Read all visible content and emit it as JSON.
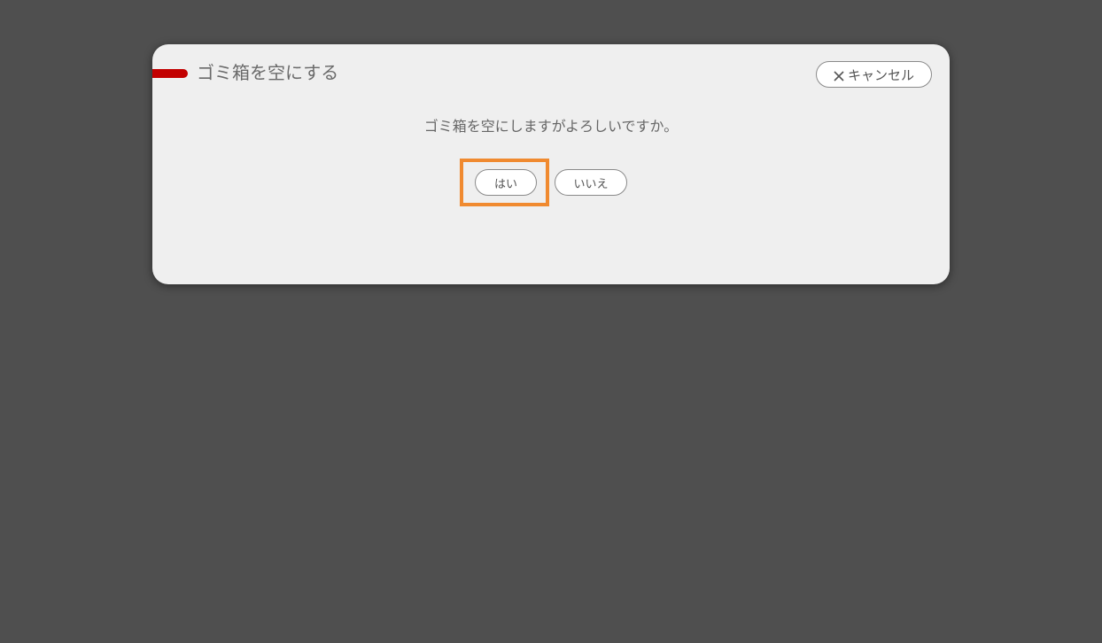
{
  "dialog": {
    "title": "ゴミ箱を空にする",
    "message": "ゴミ箱を空にしますがよろしいですか。",
    "cancel_label": "キャンセル",
    "yes_label": "はい",
    "no_label": "いいえ"
  },
  "colors": {
    "backdrop": "#4f4f4f",
    "dialog_bg": "#efefef",
    "accent": "#c20000",
    "highlight": "#f08a30"
  },
  "icons": {
    "cancel": "close-icon"
  }
}
